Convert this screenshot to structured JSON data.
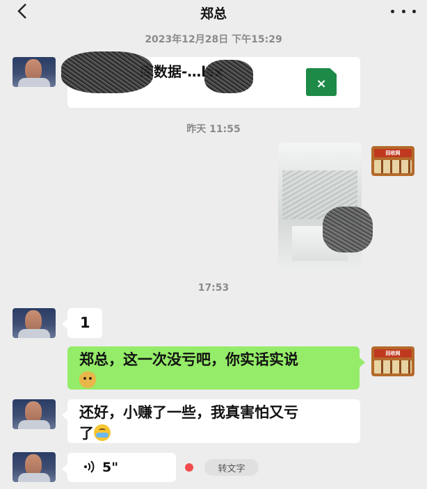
{
  "header": {
    "title": "郑总",
    "back_icon": "chevron-left-icon",
    "more_icon": "more-dots-icon"
  },
  "messages": {
    "timestamp_1": "2023年12月28日 下午15:29",
    "file_name_visible": "库数据-…lsx",
    "file_icon_glyph": "×",
    "timestamp_2": "昨天 11:55",
    "timestamp_3": "17:53",
    "msg_1": "1",
    "msg_2": "郑总，这一次没亏吧，你实话实说",
    "msg_3_line1": "还好，小赚了一些，我真害怕又亏",
    "msg_3_line2": "了",
    "voice_duration": "5\"",
    "voice_convert_label": "转文字"
  },
  "shop_avatar_sign": "回收网",
  "colors": {
    "background": "#ededed",
    "self_bubble": "#95ec69",
    "other_bubble": "#ffffff",
    "unread_dot": "#f24b4b",
    "excel_green": "#1d8a47"
  }
}
